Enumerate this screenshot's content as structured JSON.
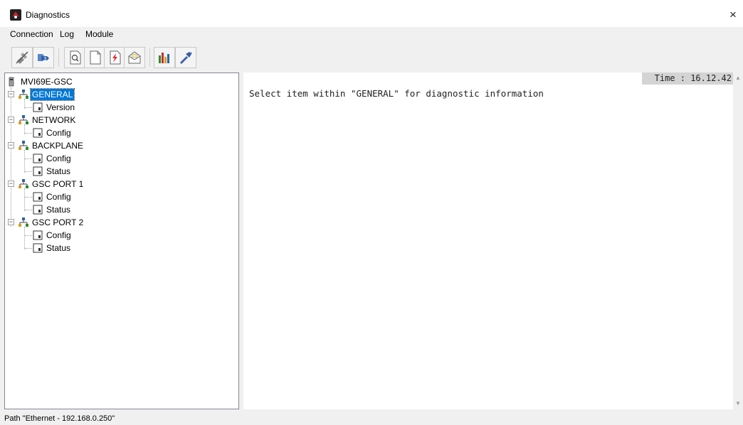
{
  "window": {
    "title": "Diagnostics",
    "close_glyph": "×"
  },
  "menu": [
    "Connection",
    "Log",
    "Module"
  ],
  "toolbar": [
    {
      "name": "disconnect-icon"
    },
    {
      "name": "connect-icon"
    },
    {
      "name": "find-icon"
    },
    {
      "name": "new-page-icon"
    },
    {
      "name": "transfer-icon"
    },
    {
      "name": "mail-icon"
    },
    {
      "name": "bar-chart-icon"
    },
    {
      "name": "tools-icon"
    }
  ],
  "tree": {
    "root": "MVI69E-GSC",
    "nodes": [
      {
        "label": "GENERAL",
        "selected": true,
        "children": [
          "Version"
        ]
      },
      {
        "label": "NETWORK",
        "children": [
          "Config"
        ]
      },
      {
        "label": "BACKPLANE",
        "children": [
          "Config",
          "Status"
        ]
      },
      {
        "label": "GSC PORT 1",
        "children": [
          "Config",
          "Status"
        ]
      },
      {
        "label": "GSC PORT 2",
        "children": [
          "Config",
          "Status"
        ]
      }
    ]
  },
  "diagnostics": {
    "time_label": "Time : 16.12.42",
    "message": "Select item within \"GENERAL\" for diagnostic information"
  },
  "status": {
    "path": "Path \"Ethernet - 192.168.0.250\""
  }
}
